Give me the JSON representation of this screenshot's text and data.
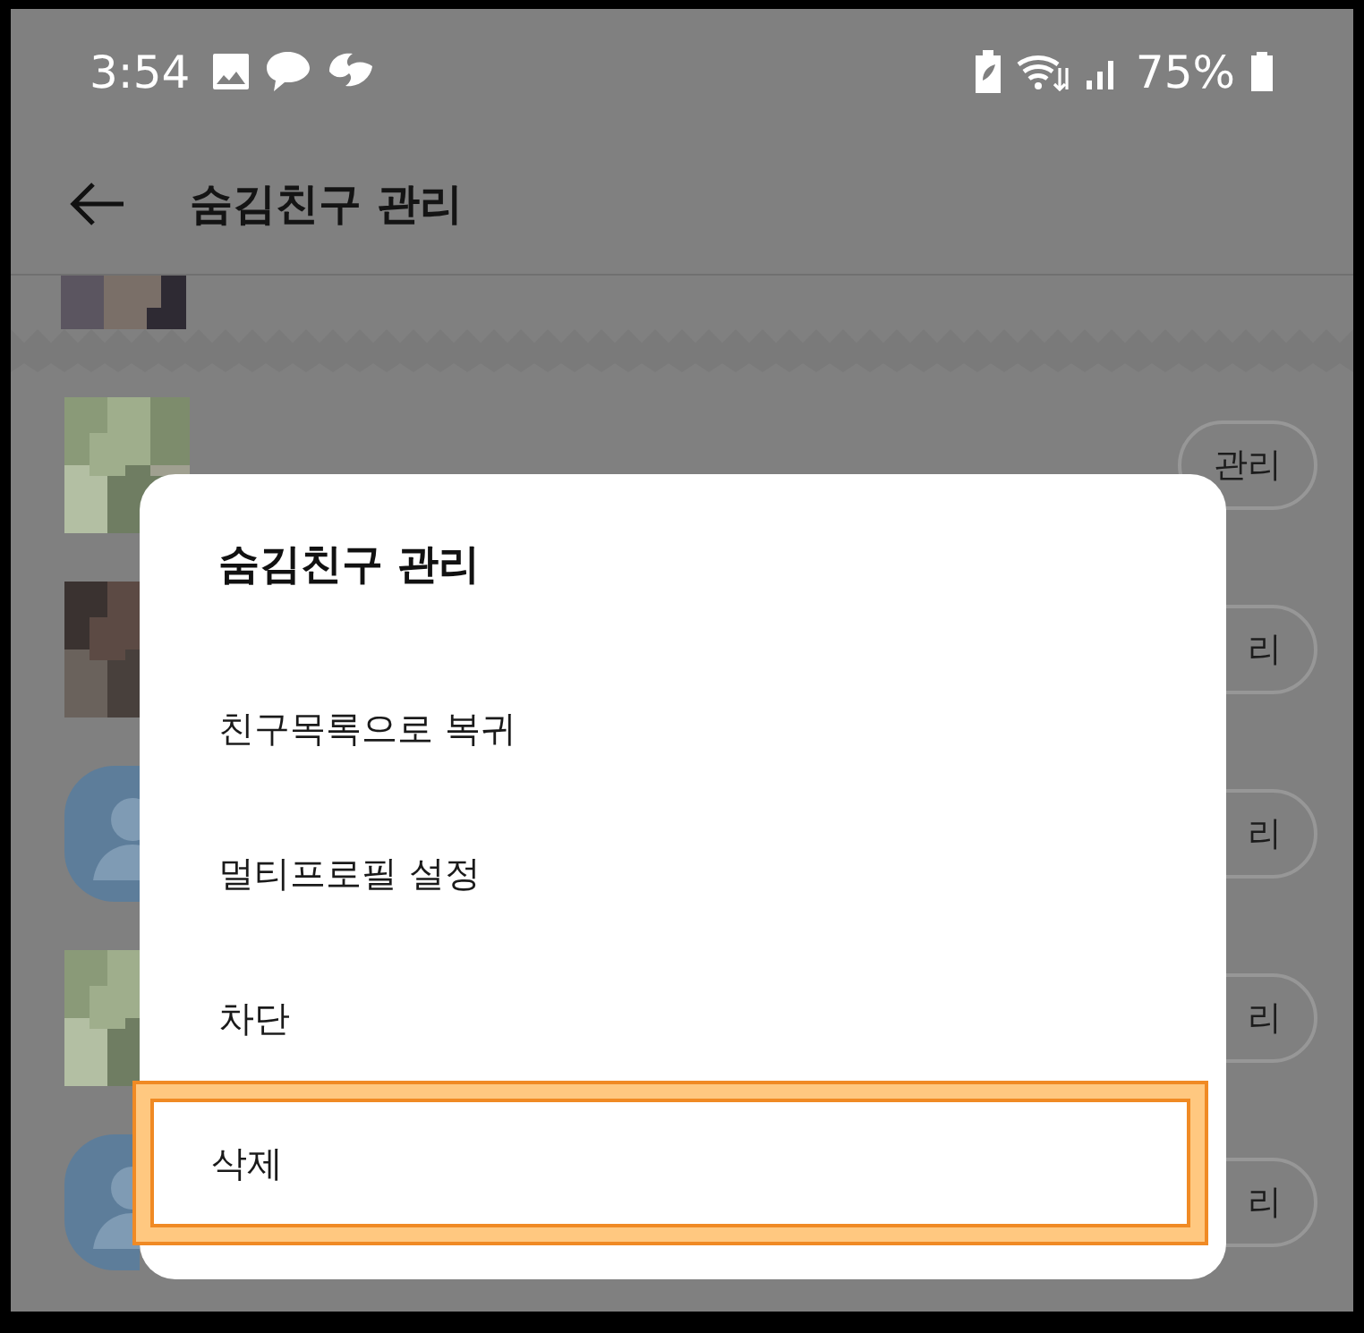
{
  "status_bar": {
    "time": "3:54",
    "battery": "75%"
  },
  "header": {
    "title": "숨김친구 관리"
  },
  "friends": [
    {
      "button": "관리"
    },
    {
      "button": "리"
    },
    {
      "kind": "default",
      "button": "리"
    },
    {
      "button": "리"
    },
    {
      "kind": "default",
      "button": "리"
    }
  ],
  "dialog": {
    "title": "숨김친구 관리",
    "items": [
      {
        "label": "친구목록으로 복귀",
        "highlighted": false
      },
      {
        "label": "멀티프로필 설정",
        "highlighted": false
      },
      {
        "label": "차단",
        "highlighted": false
      },
      {
        "label": "삭제",
        "highlighted": true
      }
    ]
  }
}
